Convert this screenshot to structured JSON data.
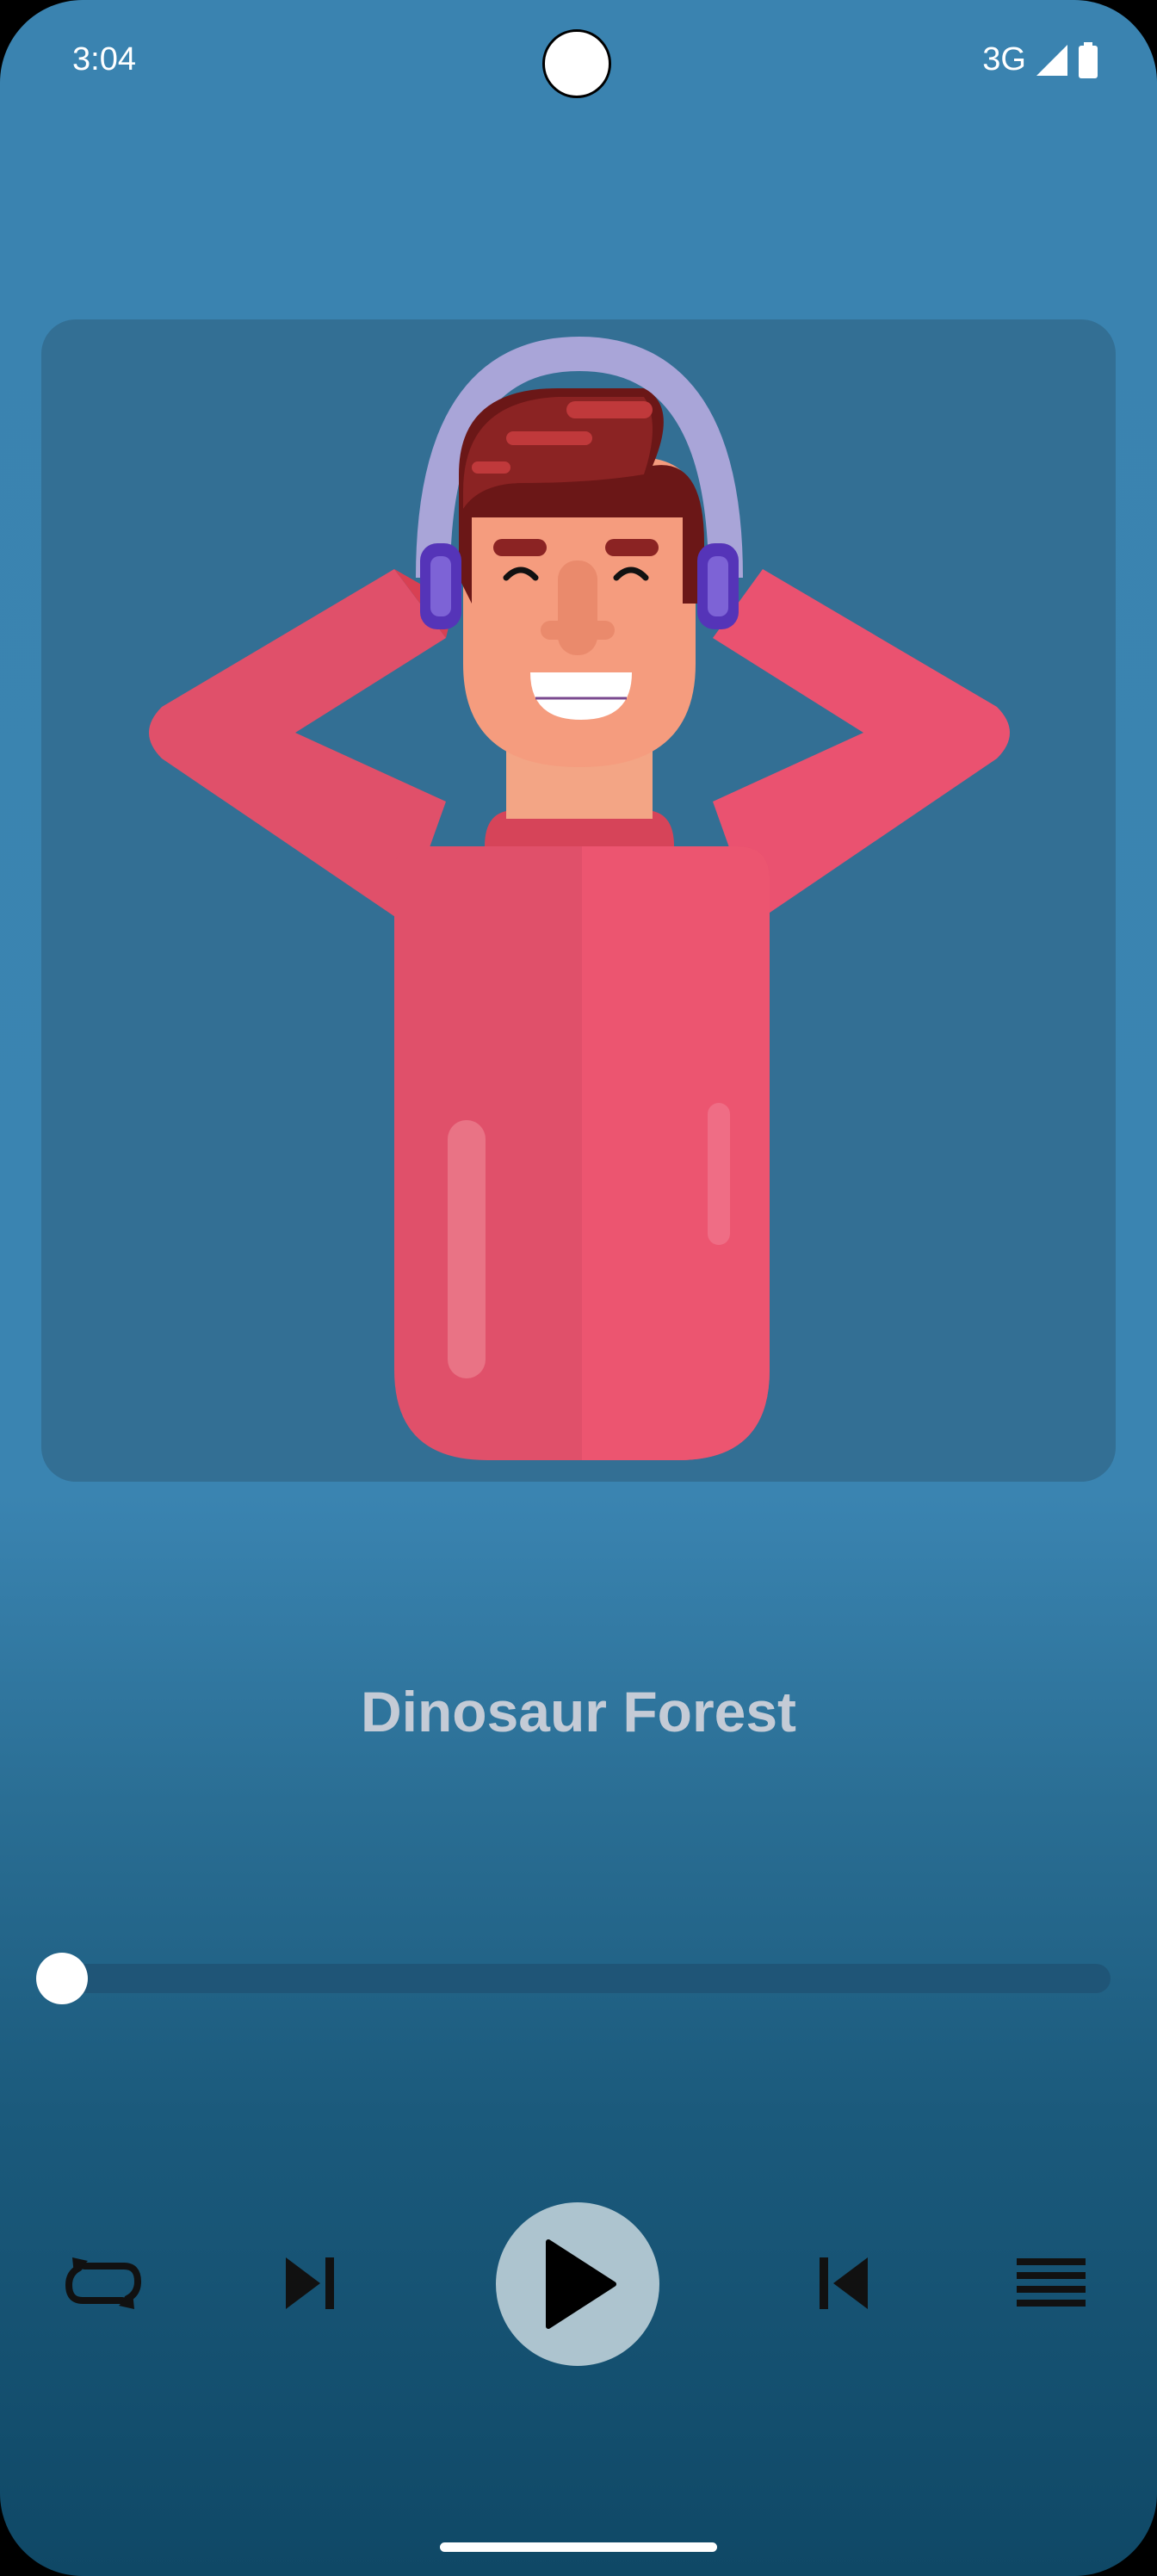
{
  "status_bar": {
    "time": "3:04",
    "network": "3G"
  },
  "player": {
    "song_title": "Dinosaur Forest",
    "progress_fraction": 0.0,
    "controls": {
      "repeat_icon": "repeat-icon",
      "next_icon": "skip-next-icon",
      "play_icon": "play-icon",
      "previous_icon": "skip-previous-icon",
      "playlist_icon": "playlist-icon"
    }
  },
  "colors": {
    "background_top": "#3a83b0",
    "background_bottom": "#0f4866",
    "card": "#336f94",
    "sweater": "#e9506a",
    "headphones": "#a8a3d6",
    "play_button": "#adc4cf"
  }
}
